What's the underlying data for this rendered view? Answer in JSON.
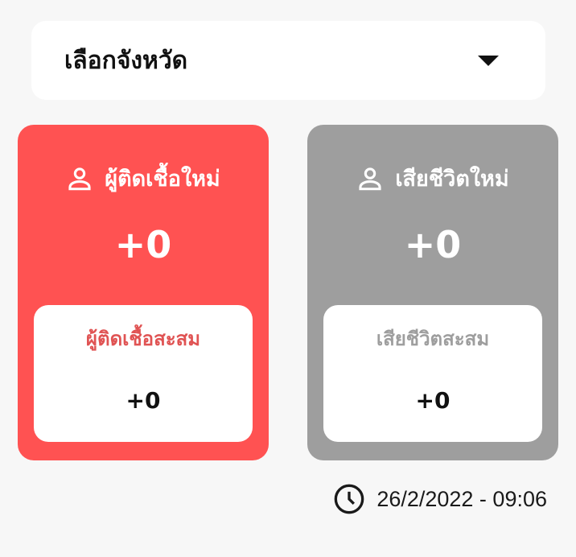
{
  "province_select": {
    "label": "เลือกจังหวัด",
    "icon": "caret-down-icon"
  },
  "cards": {
    "new_infected": {
      "title": "ผู้ติดเชื้อใหม่",
      "value": "+0",
      "icon": "person-icon",
      "color": "#ff5252",
      "cumulative_label": "ผู้ติดเชื้อสะสม",
      "cumulative_value": "+0",
      "cumulative_label_color": "#e05353"
    },
    "new_deaths": {
      "title": "เสียชีวิตใหม่",
      "value": "+0",
      "icon": "person-icon",
      "color": "#9e9e9e",
      "cumulative_label": "เสียชีวิตสะสม",
      "cumulative_value": "+0",
      "cumulative_label_color": "#9e9e9e"
    }
  },
  "updated": {
    "icon": "clock-icon",
    "text": "26/2/2022 - 09:06"
  }
}
